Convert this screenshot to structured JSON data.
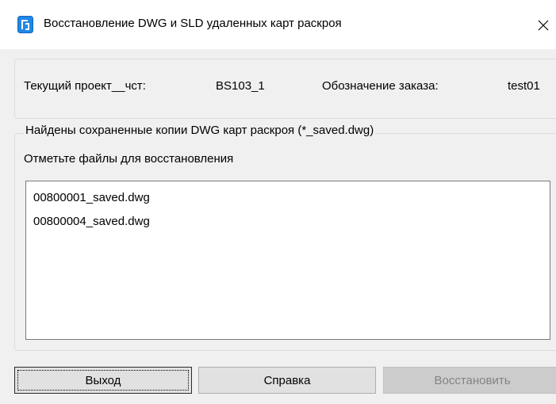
{
  "window": {
    "title": "Восстановление DWG и SLD удаленных карт раскроя",
    "close_glyph": "✕",
    "icon": "app-icon",
    "accent": "#1e88e5"
  },
  "info": {
    "project_label": "Текущий проект__чст:",
    "project_value": "BS103_1",
    "order_label": "Обозначение заказа:",
    "order_value": "test01"
  },
  "found": {
    "legend": "Найдены сохраненные копии DWG карт раскроя (*_saved.dwg)",
    "instruction": "Отметьте файлы для восстановления",
    "files": [
      "00800001_saved.dwg",
      "00800004_saved.dwg"
    ]
  },
  "buttons": {
    "exit": "Выход",
    "help": "Справка",
    "restore": "Восстановить"
  }
}
